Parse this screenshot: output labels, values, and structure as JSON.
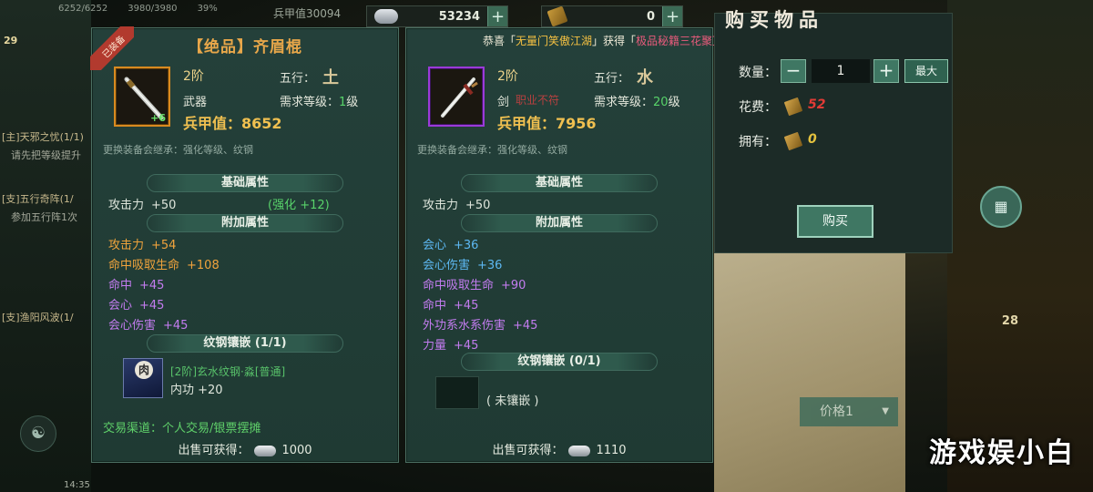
{
  "top_bar": {
    "hp": "6252/6252",
    "mp": "3980/3980",
    "pct": "39%",
    "silver_total": "兵甲值30094",
    "silver_amount": "53234",
    "gold_amount": "0"
  },
  "hud": {
    "level": "29",
    "chat": [
      "[主]天邪之忧(1/1)",
      "请先把等级提升",
      "[支]五行奇阵(1/",
      "参加五行阵1次",
      "[支]渔阳风波(1/"
    ],
    "clock": "14:35",
    "right_badge": "28",
    "side_icon": "▦",
    "meditate_icon": "☯"
  },
  "announcement": {
    "prefix": "恭喜「",
    "player": "无量门笑傲江湖",
    "mid": "」获得「",
    "item": "极品秘籍三花聚顶",
    "suffix": "」"
  },
  "left_item": {
    "equipped_tag": "已装备",
    "title": "【绝品】齐眉棍",
    "enhance": "+6",
    "grade": "2阶",
    "wuxing_label": "五行：",
    "wuxing": "土",
    "type": "武器",
    "req_label": "需求等级：",
    "req_level": "1",
    "req_suffix": "级",
    "armor_label": "兵甲值：",
    "armor": "8652",
    "hint": "更换装备会继承：强化等级、纹钢",
    "base_title": "基础属性",
    "base": [
      {
        "name": "攻击力",
        "value": "+50",
        "extra": "(强化 +12)"
      }
    ],
    "extra_title": "附加属性",
    "extra": [
      {
        "name": "攻击力",
        "value": "+54",
        "color": "#f0a33c"
      },
      {
        "name": "命中吸取生命",
        "value": "+108",
        "color": "#f0a33c"
      },
      {
        "name": "命中",
        "value": "+45",
        "color": "#c37cf0"
      },
      {
        "name": "会心",
        "value": "+45",
        "color": "#c37cf0"
      },
      {
        "name": "会心伤害",
        "value": "+45",
        "color": "#c37cf0"
      }
    ],
    "gem_title": "纹钢镶嵌 (1/1)",
    "gem_char": "肉",
    "gem_name": "[2阶]玄水纹钢·淼[普通]",
    "gem_stat": "内功  +20",
    "trade": "交易渠道：个人交易/银票摆摊",
    "sell_label": "出售可获得：",
    "sell": "1000"
  },
  "right_item": {
    "grade": "2阶",
    "wuxing_label": "五行：",
    "wuxing": "水",
    "type": "剑",
    "type_extra": "职业不符",
    "req_label": "需求等级：",
    "req_level": "20",
    "req_suffix": "级",
    "armor_label": "兵甲值：",
    "armor": "7956",
    "hint": "更换装备会继承：强化等级、纹钢",
    "base_title": "基础属性",
    "base": [
      {
        "name": "攻击力",
        "value": "+50"
      }
    ],
    "extra_title": "附加属性",
    "extra": [
      {
        "name": "会心",
        "value": "+36",
        "color": "#5db8f2"
      },
      {
        "name": "会心伤害",
        "value": "+36",
        "color": "#5db8f2"
      },
      {
        "name": "命中吸取生命",
        "value": "+90",
        "color": "#c37cf0"
      },
      {
        "name": "命中",
        "value": "+45",
        "color": "#c37cf0"
      },
      {
        "name": "外功系水系伤害",
        "value": "+45",
        "color": "#c37cf0"
      },
      {
        "name": "力量",
        "value": "+45",
        "color": "#c37cf0"
      }
    ],
    "gem_title": "纹钢镶嵌 (0/1)",
    "gem_none": "( 未镶嵌 )",
    "sell_label": "出售可获得：",
    "sell": "1110"
  },
  "buy_dialog": {
    "title": "购买物品",
    "qty_label": "数量：",
    "qty": "1",
    "minus": "−",
    "plus": "+",
    "max": "最大",
    "cost_label": "花费：",
    "cost": "52",
    "own_label": "拥有：",
    "own": "0",
    "buy": "购买",
    "price_filter": "价格1"
  },
  "watermark": "游戏娱小白"
}
